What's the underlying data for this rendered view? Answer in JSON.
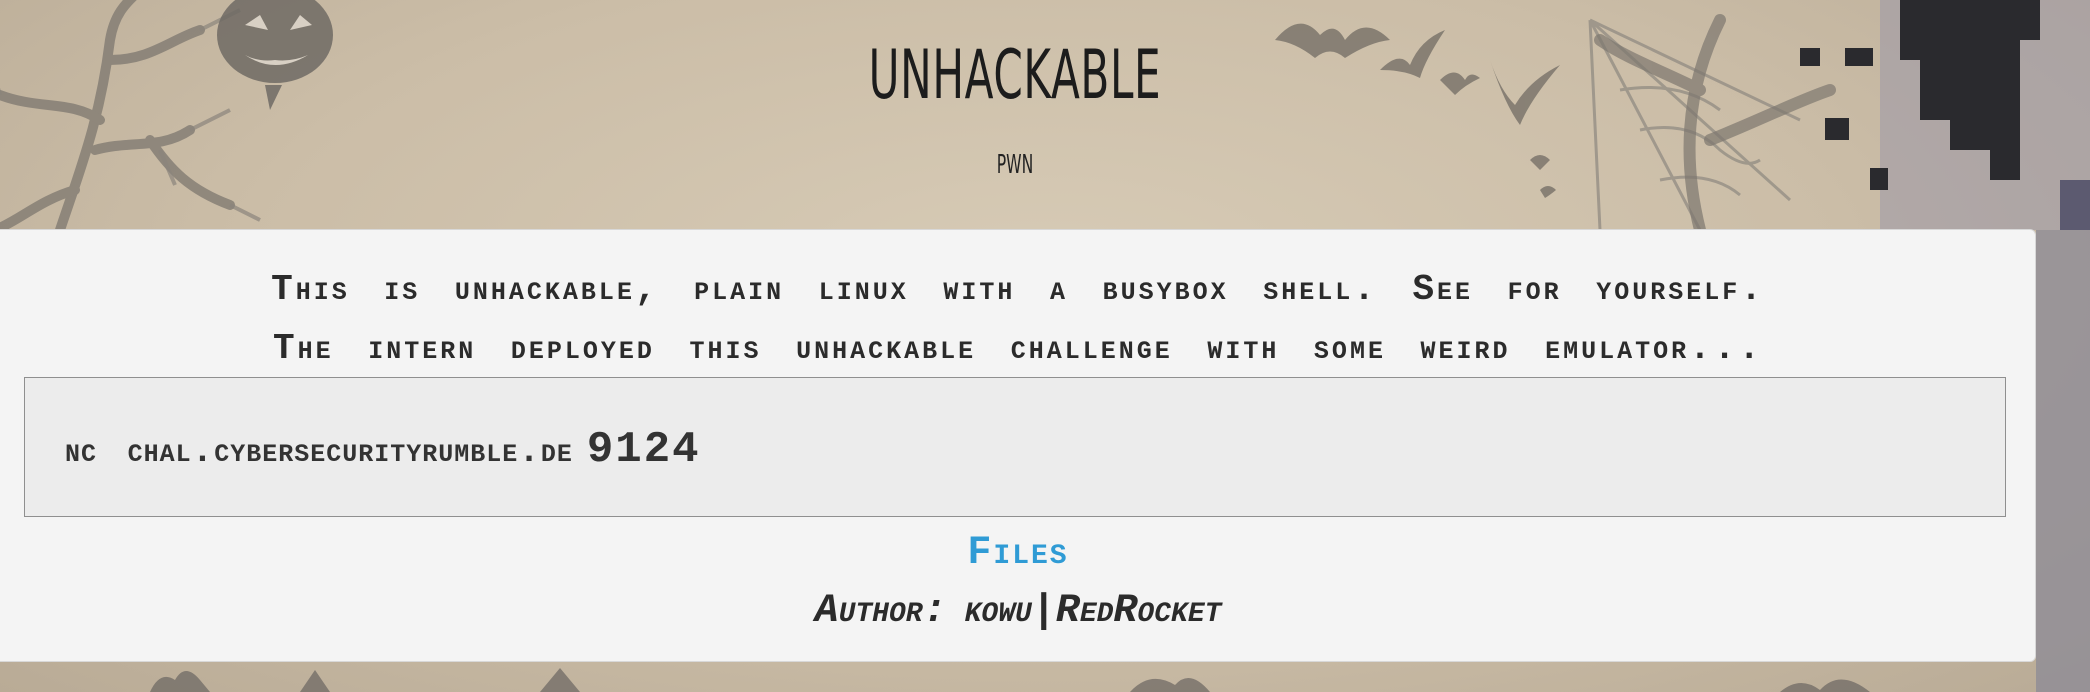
{
  "challenge": {
    "title": "UNHACKABLE",
    "category": "PWN",
    "description_line1": "This is unhackable, plain linux with a busybox shell. See for yourself.",
    "description_line2": "The intern deployed this unhackable challenge with some weird emulator...",
    "connection": {
      "command": "nc chal.cybersecurityrumble.de",
      "port": "9124"
    },
    "files_label": "Files",
    "author_label": "Author:",
    "author_name": "kowu|RedRocket"
  },
  "colors": {
    "card_background": "#f4f4f4",
    "codebox_background": "#ececec",
    "link": "#2f9bd5",
    "text": "#2b2b2b",
    "page_background": "#c9bca8"
  }
}
